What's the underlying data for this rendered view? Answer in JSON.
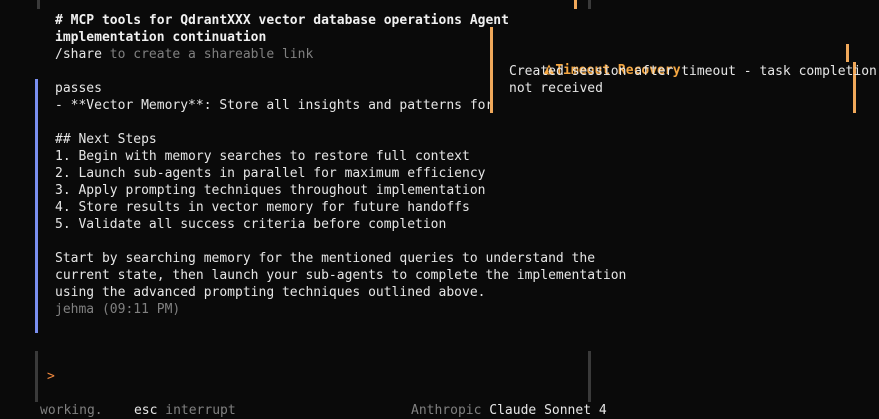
{
  "message": {
    "header_line1": "# MCP tools for QdrantXXX vector database operations Agent",
    "header_line2": "implementation continuation",
    "share_cmd": "/share",
    "share_text": " to create a shareable link",
    "passes": "passes",
    "vector_memory_line": "- **Vector Memory**: Store all insights and patterns for futur",
    "next_steps_heading": "## Next Steps",
    "steps": [
      "1. Begin with memory searches to restore full context",
      "2. Launch sub-agents in parallel for maximum efficiency",
      "3. Apply prompting techniques throughout implementation",
      "4. Store results in vector memory for future handoffs",
      "5. Validate all success criteria before completion"
    ],
    "closing": [
      "Start by searching memory for the mentioned queries to understand the",
      "current state, then launch your sub-agents to complete the implementation",
      "using the advanced prompting techniques outlined above."
    ],
    "author": "jehma (09:11 PM)"
  },
  "toast": {
    "icon": "warning-icon",
    "title": "Timeout Recovery",
    "body_line1": "Created session after timeout - task completion",
    "body_line2": "not received"
  },
  "input": {
    "prompt_symbol": ">"
  },
  "status": {
    "working": "working.",
    "esc_key": "esc",
    "esc_action": " interrupt",
    "provider": "Anthropic",
    "model": "Claude Sonnet 4"
  },
  "colors": {
    "accent": "#f5a742",
    "message_bar": "#7a8ff0",
    "background": "#0a0a0a"
  }
}
